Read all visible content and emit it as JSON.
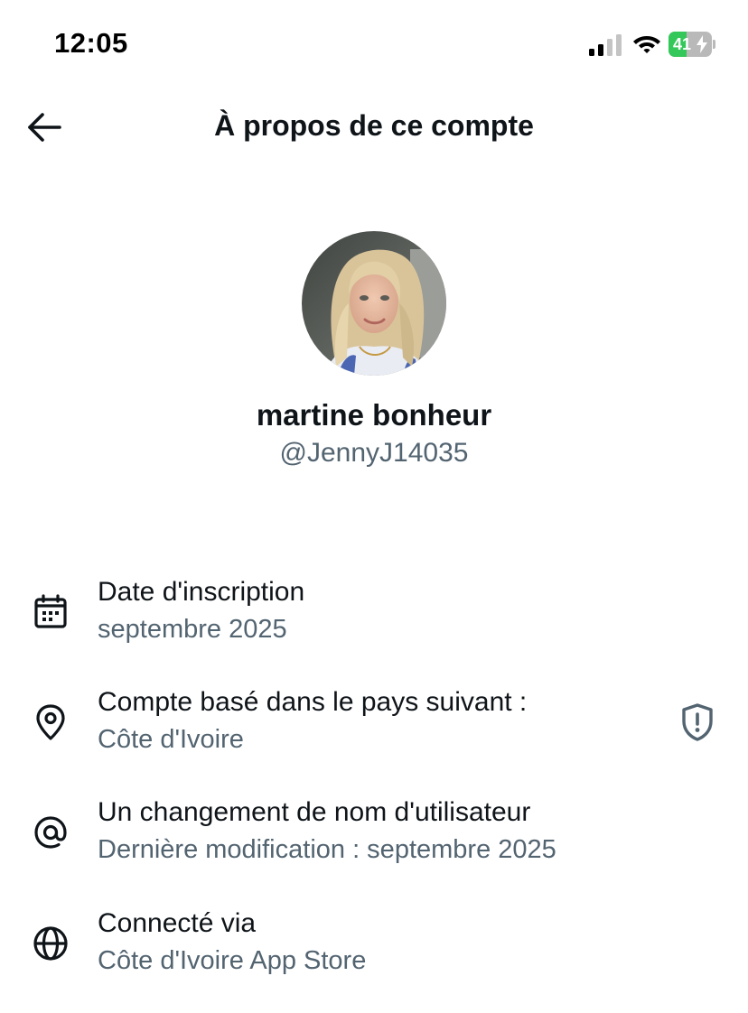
{
  "status_bar": {
    "time": "12:05",
    "battery_level": "41",
    "battery_percent": 41,
    "battery_color": "#34c759",
    "icons": [
      "cellular-signal-icon",
      "wifi-icon",
      "battery-charging-icon"
    ]
  },
  "header": {
    "title": "À propos de ce compte",
    "back_icon": "arrow-left-icon"
  },
  "profile": {
    "display_name": "martine bonheur",
    "handle": "@JennyJ14035"
  },
  "info": [
    {
      "icon": "calendar-icon",
      "title": "Date d'inscription",
      "subtitle": "septembre 2025"
    },
    {
      "icon": "location-pin-icon",
      "title": "Compte basé dans le pays suivant :",
      "subtitle": "Côte d'Ivoire",
      "trailing_icon": "shield-alert-icon"
    },
    {
      "icon": "at-sign-icon",
      "title": "Un changement de nom d'utilisateur",
      "subtitle": "Dernière modification : septembre 2025"
    },
    {
      "icon": "globe-icon",
      "title": "Connecté via",
      "subtitle": "Côte d'Ivoire App Store"
    }
  ],
  "colors": {
    "text_primary": "#0f1419",
    "text_secondary": "#536471",
    "background": "#ffffff"
  }
}
